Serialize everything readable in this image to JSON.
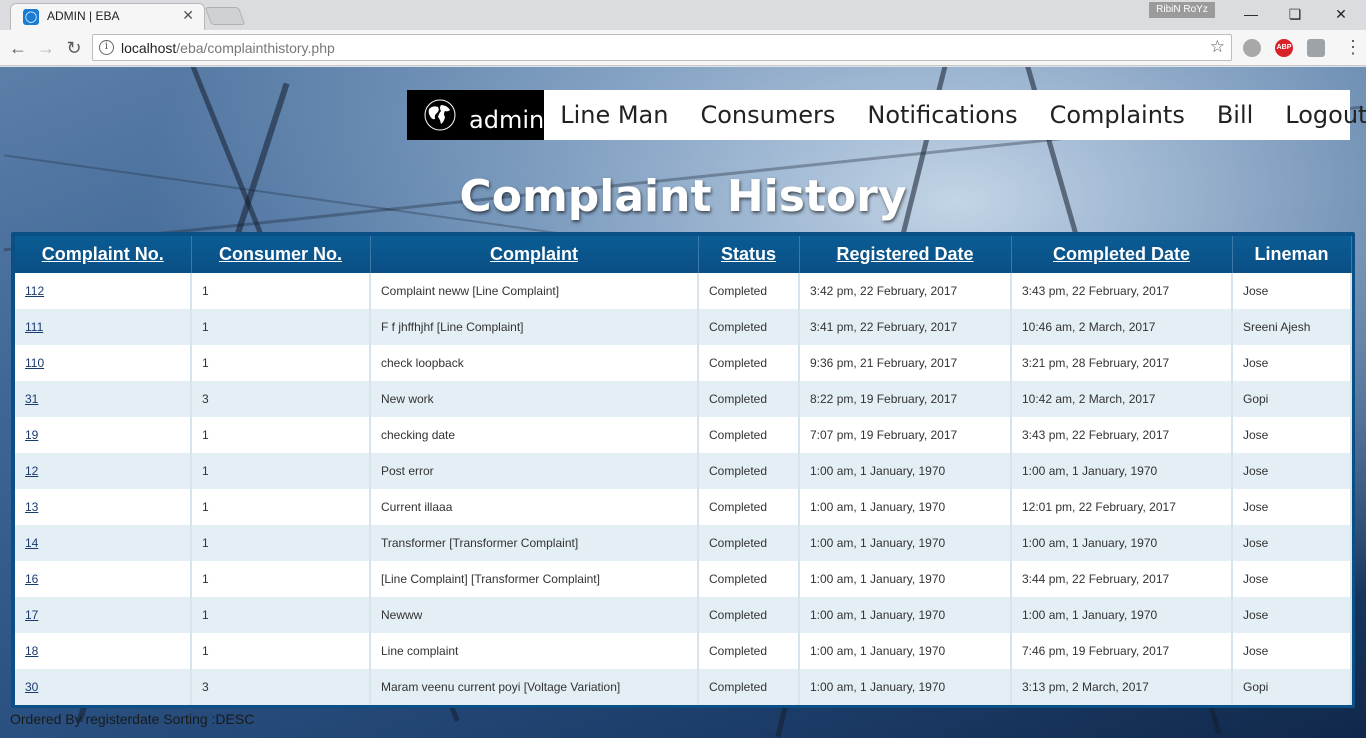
{
  "browser": {
    "tab_title": "ADMIN | EBA",
    "profile": "RibiN RoYz",
    "url_host": "localhost",
    "url_path": "/eba/complainthistory.php",
    "extensions": [
      "globe-icon",
      "abp-icon",
      "shield-icon"
    ],
    "abp_label": "ABP"
  },
  "nav": {
    "brand": "admin",
    "items": [
      "Line Man",
      "Consumers",
      "Notifications",
      "Complaints",
      "Bill",
      "Logout"
    ]
  },
  "page": {
    "title": "Complaint History",
    "footer": "Ordered By registerdate Sorting :DESC"
  },
  "table": {
    "headers": [
      "Complaint No.",
      "Consumer No.",
      "Complaint",
      "Status",
      "Registered Date",
      "Completed Date",
      "Lineman"
    ],
    "rows": [
      [
        "112",
        "1",
        "Complaint neww [Line Complaint]",
        "Completed",
        "3:42 pm, 22 February, 2017",
        "3:43 pm, 22 February, 2017",
        "Jose"
      ],
      [
        "111",
        "1",
        "F f jhffhjhf [Line Complaint]",
        "Completed",
        "3:41 pm, 22 February, 2017",
        "10:46 am, 2 March, 2017",
        "Sreeni Ajesh"
      ],
      [
        "110",
        "1",
        "check loopback",
        "Completed",
        "9:36 pm, 21 February, 2017",
        "3:21 pm, 28 February, 2017",
        "Jose"
      ],
      [
        "31",
        "3",
        "New work",
        "Completed",
        "8:22 pm, 19 February, 2017",
        "10:42 am, 2 March, 2017",
        "Gopi"
      ],
      [
        "19",
        "1",
        "checking date",
        "Completed",
        "7:07 pm, 19 February, 2017",
        "3:43 pm, 22 February, 2017",
        "Jose"
      ],
      [
        "12",
        "1",
        "Post error",
        "Completed",
        "1:00 am, 1 January, 1970",
        "1:00 am, 1 January, 1970",
        "Jose"
      ],
      [
        "13",
        "1",
        "Current illaaa",
        "Completed",
        "1:00 am, 1 January, 1970",
        "12:01 pm, 22 February, 2017",
        "Jose"
      ],
      [
        "14",
        "1",
        "Transformer [Transformer Complaint]",
        "Completed",
        "1:00 am, 1 January, 1970",
        "1:00 am, 1 January, 1970",
        "Jose"
      ],
      [
        "16",
        "1",
        "[Line Complaint] [Transformer Complaint]",
        "Completed",
        "1:00 am, 1 January, 1970",
        "3:44 pm, 22 February, 2017",
        "Jose"
      ],
      [
        "17",
        "1",
        "Newww",
        "Completed",
        "1:00 am, 1 January, 1970",
        "1:00 am, 1 January, 1970",
        "Jose"
      ],
      [
        "18",
        "1",
        "Line complaint",
        "Completed",
        "1:00 am, 1 January, 1970",
        "7:46 pm, 19 February, 2017",
        "Jose"
      ],
      [
        "30",
        "3",
        "Maram veenu current poyi [Voltage Variation]",
        "Completed",
        "1:00 am, 1 January, 1970",
        "3:13 pm, 2 March, 2017",
        "Gopi"
      ]
    ]
  }
}
